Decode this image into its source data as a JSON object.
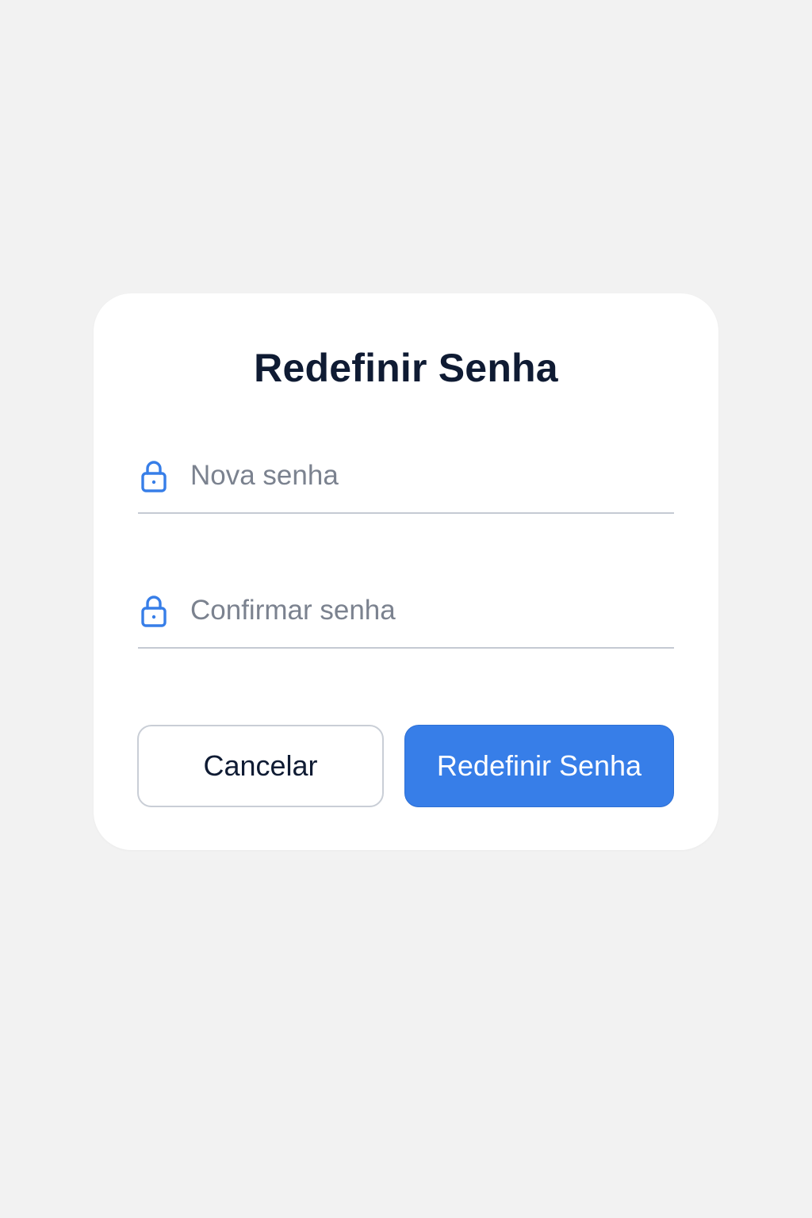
{
  "dialog": {
    "title": "Redefinir Senha"
  },
  "fields": {
    "new_password": {
      "placeholder": "Nova senha",
      "value": "",
      "icon": "lock-icon"
    },
    "confirm_password": {
      "placeholder": "Confirmar senha",
      "value": "",
      "icon": "lock-icon"
    }
  },
  "actions": {
    "cancel_label": "Cancelar",
    "submit_label": "Redefinir Senha"
  },
  "colors": {
    "accent": "#377ee8",
    "title": "#0f1b33",
    "background": "#f2f2f2",
    "card": "#ffffff"
  }
}
